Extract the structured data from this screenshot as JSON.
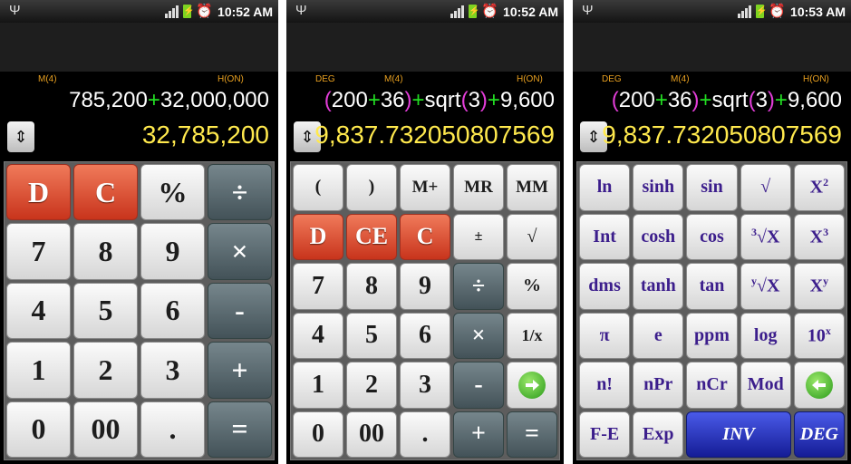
{
  "status": {
    "time1": "10:52 AM",
    "time2": "10:52 AM",
    "time3": "10:53 AM"
  },
  "screen1": {
    "indicators": {
      "memory": "M(4)",
      "history": "H(ON)"
    },
    "expression": {
      "a": "785,200",
      "op": "+",
      "b": "32,000,000"
    },
    "result": "32,785,200",
    "keys": [
      "D",
      "C",
      "%",
      "÷",
      "7",
      "8",
      "9",
      "×",
      "4",
      "5",
      "6",
      "-",
      "1",
      "2",
      "3",
      "+",
      "0",
      "00",
      ".",
      "="
    ]
  },
  "screen2": {
    "indicators": {
      "angle": "DEG",
      "memory": "M(4)",
      "history": "H(ON)"
    },
    "expression": {
      "p1": "(",
      "n1": "200",
      "op1": "+",
      "n2": "36",
      "p2": ")",
      "op2": "+",
      "fn": "sqrt",
      "p3": "(",
      "n3": "3",
      "p4": ")",
      "op3": "+",
      "n4": "9,600"
    },
    "result": "9,837.732050807569",
    "keys": [
      "(",
      ")",
      "M+",
      "MR",
      "MM",
      "D",
      "CE",
      "C",
      "±",
      "√",
      "7",
      "8",
      "9",
      "÷",
      "%",
      "4",
      "5",
      "6",
      "×",
      "1/x",
      "1",
      "2",
      "3",
      "-",
      "0",
      "00",
      ".",
      "+",
      "="
    ]
  },
  "screen3": {
    "indicators": {
      "angle": "DEG",
      "memory": "M(4)",
      "history": "H(ON)"
    },
    "expression": {
      "p1": "(",
      "n1": "200",
      "op1": "+",
      "n2": "36",
      "p2": ")",
      "op2": "+",
      "fn": "sqrt",
      "p3": "(",
      "n3": "3",
      "p4": ")",
      "op3": "+",
      "n4": "9,600"
    },
    "result": "9,837.732050807569",
    "keys": [
      "ln",
      "sinh",
      "sin",
      "√",
      "Int",
      "cosh",
      "cos",
      "dms",
      "tanh",
      "tan",
      "π",
      "e",
      "ppm",
      "log",
      "n!",
      "nPr",
      "nCr",
      "Mod",
      "F-E",
      "Exp",
      "INV",
      "DEG"
    ],
    "power_keys": {
      "x2_base": "X",
      "x2_exp": "2",
      "x3_base": "X",
      "x3_exp": "3",
      "cbrt_idx": "3",
      "cbrt_rad": "√X",
      "yroot_idx": "y",
      "yroot_rad": "√X",
      "xy_base": "X",
      "xy_exp": "y",
      "ten_base": "10",
      "ten_exp": "x"
    }
  },
  "icons": {
    "usb": "usb-icon",
    "signal": "signal-icon",
    "battery": "battery-charging-icon",
    "alarm": "alarm-icon",
    "swap": "swap-arrows-icon",
    "enter": "enter-arrow-icon",
    "back": "back-arrow-icon"
  },
  "colors": {
    "operator": "#22dd22",
    "paren": "#e23dd8",
    "result": "#ffe94d",
    "indicator": "#e8a020"
  }
}
